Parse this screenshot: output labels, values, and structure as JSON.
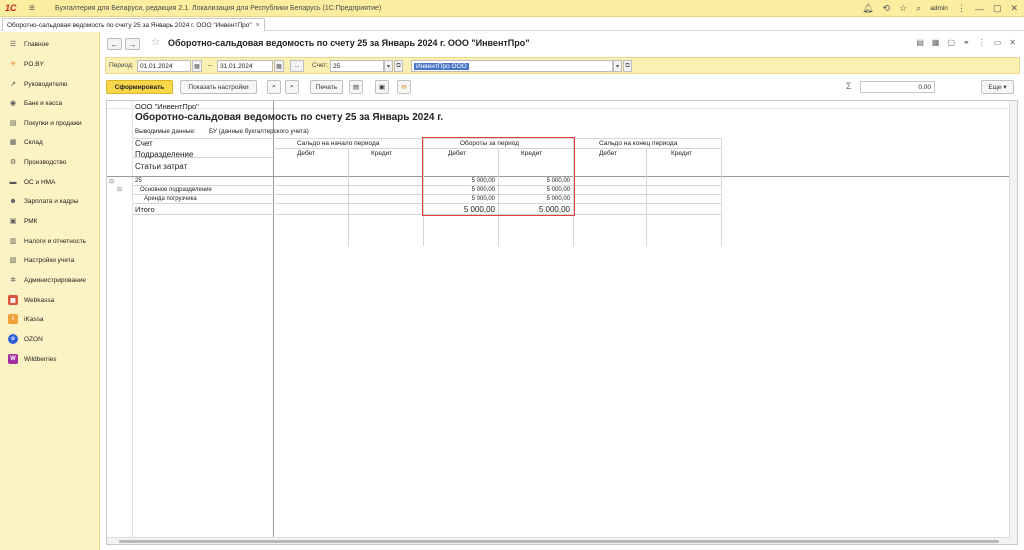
{
  "topbar": {
    "logo": "1С",
    "app_title": "Бухгалтерия для Беларуси, редакция 2.1. Локализация для Республики Беларусь   (1С:Предприятие)",
    "user": "admin"
  },
  "tab": {
    "label": "Оборотно-сальдовая ведомость по счету 25 за Январь 2024 г. ООО \"ИнвентПро\"",
    "close": "×"
  },
  "sidebar": {
    "items": [
      {
        "label": "Главное",
        "icon": "menu-icon"
      },
      {
        "label": "PO.BY",
        "icon": "sun-icon"
      },
      {
        "label": "Руководителю",
        "icon": "trend-icon"
      },
      {
        "label": "Банк и касса",
        "icon": "bank-icon"
      },
      {
        "label": "Покупки и продажи",
        "icon": "cart-icon"
      },
      {
        "label": "Склад",
        "icon": "warehouse-icon"
      },
      {
        "label": "Производство",
        "icon": "factory-icon"
      },
      {
        "label": "ОС и НМА",
        "icon": "assets-icon"
      },
      {
        "label": "Зарплата и кадры",
        "icon": "people-icon"
      },
      {
        "label": "РМК",
        "icon": "register-icon"
      },
      {
        "label": "Налоги и отчетность",
        "icon": "taxes-icon"
      },
      {
        "label": "Настройки учета",
        "icon": "settings-icon"
      },
      {
        "label": "Администрирование",
        "icon": "gear-icon"
      },
      {
        "label": "Webkassa",
        "icon": "webkassa-icon"
      },
      {
        "label": "iKassa",
        "icon": "ikassa-icon"
      },
      {
        "label": "OZON",
        "icon": "ozon-icon"
      },
      {
        "label": "Wildberries",
        "icon": "wildberries-icon"
      }
    ]
  },
  "doc": {
    "title": "Оборотно-сальдовая ведомость по счету 25 за Январь 2024 г. ООО \"ИнвентПро\""
  },
  "params": {
    "period_label": "Период:",
    "date_from": "01.01.2024",
    "dash": "–",
    "date_to": "31.01.2024",
    "dots": "...",
    "account_label": "Счет:",
    "account": "25",
    "organization": "ИнвентПро ООО"
  },
  "toolbar": {
    "generate": "Сформировать",
    "show_settings": "Показать настройки",
    "print": "Печать",
    "more": "Еще",
    "sum_symbol": "Σ",
    "sum_value": "0,00"
  },
  "report": {
    "org": "ООО \"ИнвентПро\"",
    "title": "Оборотно-сальдовая ведомость по счету 25 за Январь 2024 г.",
    "data_label": "Выводимые данные:",
    "data_value": "БУ (данные бухгалтерского учета)",
    "col_headers": {
      "account": "Счет",
      "division": "Подразделение",
      "costs": "Статьи затрат",
      "opening": "Сальдо на начало периода",
      "turnover": "Обороты за период",
      "closing": "Сальдо на конец периода",
      "debit": "Дебет",
      "credit": "Кредит"
    },
    "rows": [
      {
        "label": "25",
        "debit": "5 000,00",
        "credit": "5 000,00"
      },
      {
        "label": "Основное подразделение",
        "debit": "5 000,00",
        "credit": "5 000,00"
      },
      {
        "label": "Аренда погрузчика",
        "debit": "5 000,00",
        "credit": "5 000,00"
      }
    ],
    "total": {
      "label": "Итого",
      "debit": "5 000,00",
      "credit": "5 000,00"
    }
  }
}
